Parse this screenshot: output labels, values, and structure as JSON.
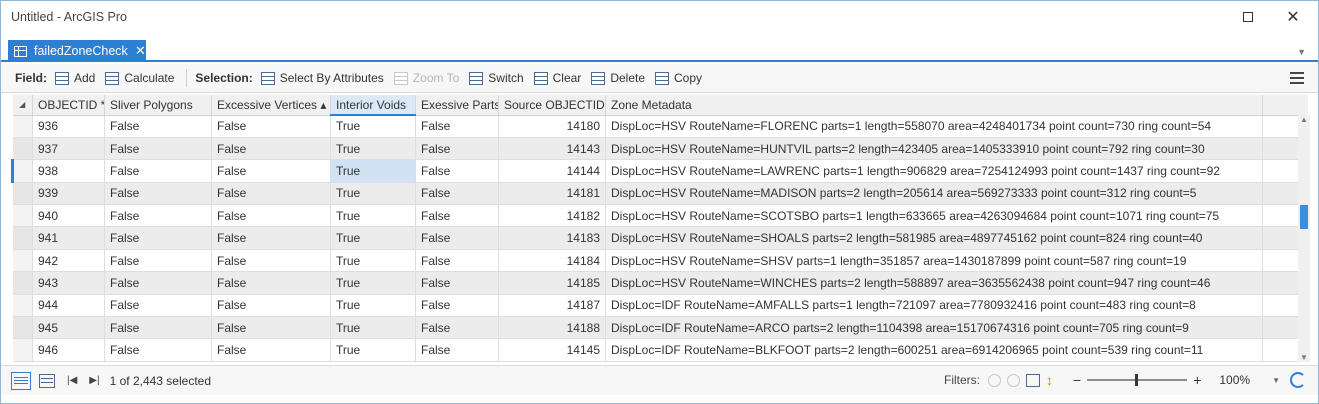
{
  "window": {
    "title": "Untitled - ArcGIS Pro"
  },
  "tab": {
    "label": "failedZoneCheck",
    "close": "✕"
  },
  "toolbar": {
    "field_label": "Field:",
    "add": "Add",
    "calculate": "Calculate",
    "selection_label": "Selection:",
    "select_by_attributes": "Select By Attributes",
    "zoom_to": "Zoom To",
    "switch": "Switch",
    "clear": "Clear",
    "delete": "Delete",
    "copy": "Copy"
  },
  "table": {
    "columns": [
      "OBJECTID *",
      "Sliver Polygons",
      "Excessive Vertices ▴",
      "Interior Voids",
      "Exessive Parts",
      "Source OBJECTID",
      "Zone Metadata"
    ],
    "rows": [
      [
        "936",
        "False",
        "False",
        "True",
        "False",
        "14180",
        "DispLoc=HSV RouteName=FLORENC parts=1 length=558070 area=4248401734 point count=730 ring count=54"
      ],
      [
        "937",
        "False",
        "False",
        "True",
        "False",
        "14143",
        "DispLoc=HSV RouteName=HUNTVIL parts=2 length=423405 area=1405333910 point count=792 ring count=30"
      ],
      [
        "938",
        "False",
        "False",
        "True",
        "False",
        "14144",
        "DispLoc=HSV RouteName=LAWRENC parts=1 length=906829 area=7254124993 point count=1437 ring count=92"
      ],
      [
        "939",
        "False",
        "False",
        "True",
        "False",
        "14181",
        "DispLoc=HSV RouteName=MADISON parts=2 length=205614 area=569273333 point count=312 ring count=5"
      ],
      [
        "940",
        "False",
        "False",
        "True",
        "False",
        "14182",
        "DispLoc=HSV RouteName=SCOTSBO parts=1 length=633665 area=4263094684 point count=1071 ring count=75"
      ],
      [
        "941",
        "False",
        "False",
        "True",
        "False",
        "14183",
        "DispLoc=HSV RouteName=SHOALS parts=2 length=581985 area=4897745162 point count=824 ring count=40"
      ],
      [
        "942",
        "False",
        "False",
        "True",
        "False",
        "14184",
        "DispLoc=HSV RouteName=SHSV parts=1 length=351857 area=1430187899 point count=587 ring count=19"
      ],
      [
        "943",
        "False",
        "False",
        "True",
        "False",
        "14185",
        "DispLoc=HSV RouteName=WINCHES parts=2 length=588897 area=3635562438 point count=947 ring count=46"
      ],
      [
        "944",
        "False",
        "False",
        "True",
        "False",
        "14187",
        "DispLoc=IDF RouteName=AMFALLS parts=1 length=721097 area=7780932416 point count=483 ring count=8"
      ],
      [
        "945",
        "False",
        "False",
        "True",
        "False",
        "14188",
        "DispLoc=IDF RouteName=ARCO parts=2 length=1104398 area=15170674316 point count=705 ring count=9"
      ],
      [
        "946",
        "False",
        "False",
        "True",
        "False",
        "14145",
        "DispLoc=IDF RouteName=BLKFOOT parts=2 length=600251 area=6914206965 point count=539 ring count=11"
      ]
    ]
  },
  "status": {
    "selected_text": "1 of 2,443 selected",
    "filters_label": "Filters:",
    "zoom": "100%"
  }
}
